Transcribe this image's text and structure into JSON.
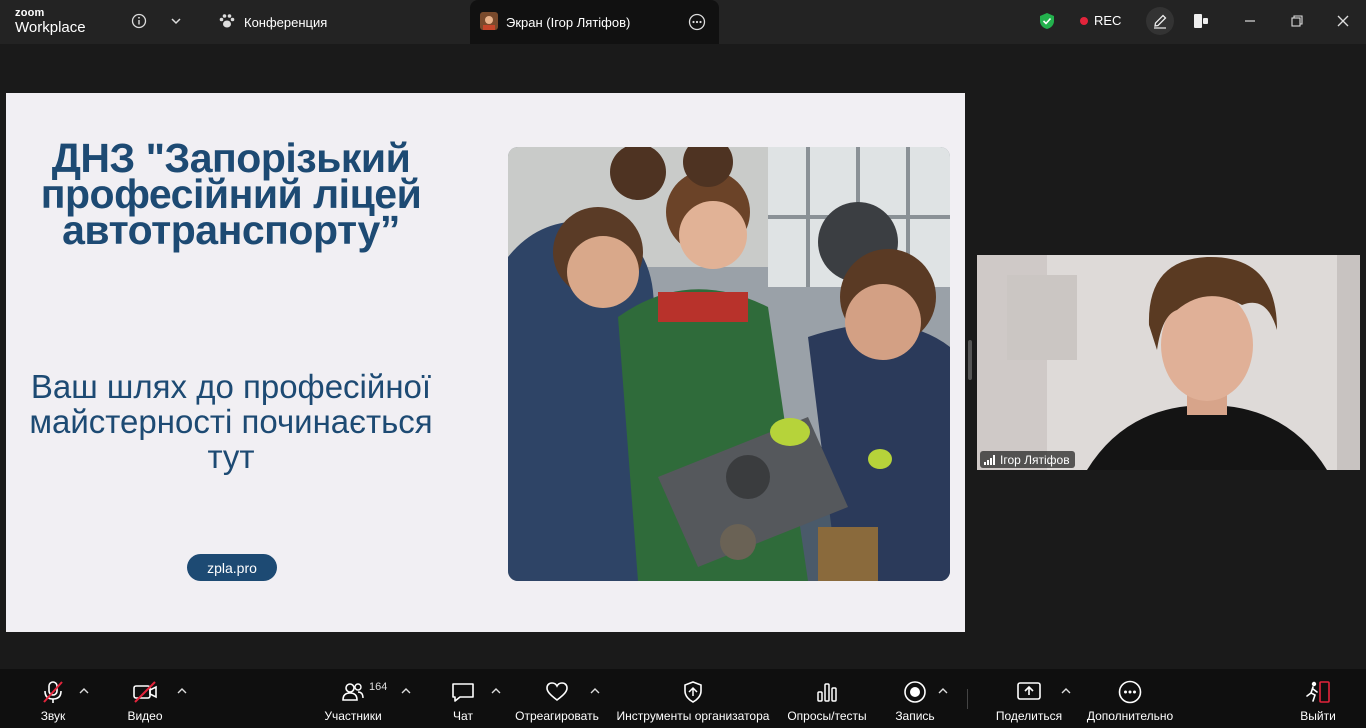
{
  "app": {
    "brand_top": "zoom",
    "brand_bottom": "Workplace"
  },
  "tabs": [
    {
      "label": "Конференция"
    },
    {
      "label": "Экран (Ігор Лятіфов)"
    }
  ],
  "status": {
    "rec_label": "REC"
  },
  "slide": {
    "title": "ДНЗ \"Запорізький професійний ліцей автотранспорту”",
    "subtitle": "Ваш шлях до професійної майстерності починається тут",
    "link": "zpla.pro"
  },
  "participant": {
    "name": "Ігор Лятіфов"
  },
  "toolbar": {
    "audio": "Звук",
    "video": "Видео",
    "participants": "Участники",
    "participants_count": "164",
    "chat": "Чат",
    "react": "Отреагировать",
    "host_tools": "Инструменты организатора",
    "polls": "Опросы/тесты",
    "record": "Запись",
    "share": "Поделиться",
    "more": "Дополнительно",
    "leave": "Выйти"
  },
  "colors": {
    "slide_text": "#1d4a73",
    "rec": "#e3243b",
    "leave": "#e3243b",
    "shield": "#23b14d"
  }
}
